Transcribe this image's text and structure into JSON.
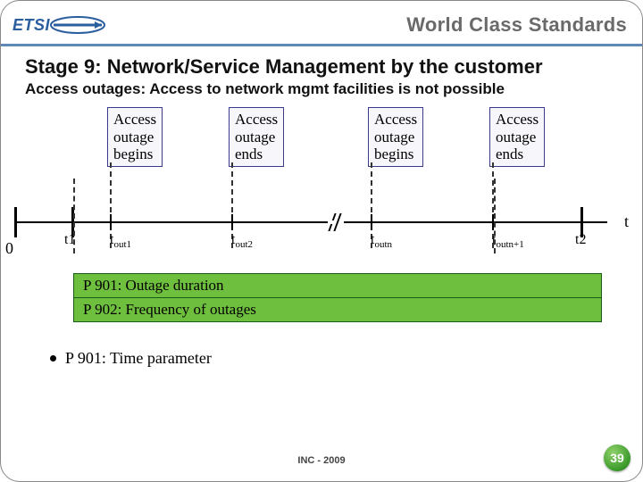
{
  "header": {
    "logo_text": "ETSI",
    "tagline": "World Class Standards"
  },
  "title": "Stage 9: Network/Service Management by the customer",
  "subtitle": "Access outages: Access to network mgmt facilities is not possible",
  "events": [
    {
      "label": "Access\noutage\nbegins",
      "tick": "t",
      "sub": "out1"
    },
    {
      "label": "Access\noutage\nends",
      "tick": "t",
      "sub": "out2"
    },
    {
      "label": "Access\noutage\nbegins",
      "tick": "t",
      "sub": "outn"
    },
    {
      "label": "Access\noutage\nends",
      "tick": "t",
      "sub": "outn+1"
    }
  ],
  "axis": {
    "origin": "0",
    "t1": "t1",
    "t2": "t2",
    "t": "t"
  },
  "info": {
    "row1": "P 901: Outage duration",
    "row2": "P 902: Frequency of outages"
  },
  "bullet": "P 901: Time parameter",
  "footer": "INC - 2009",
  "page": "39"
}
